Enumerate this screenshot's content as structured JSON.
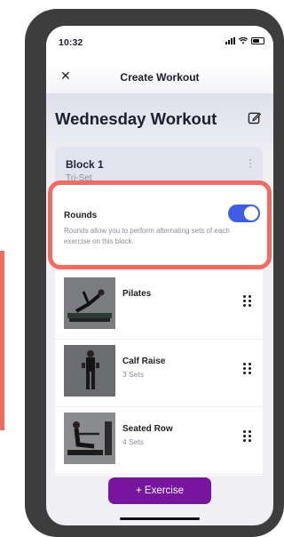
{
  "status": {
    "time": "10:32"
  },
  "nav": {
    "close_icon": "close-icon",
    "title": "Create Workout"
  },
  "workout": {
    "title": "Wednesday Workout",
    "edit_icon": "edit-icon"
  },
  "block": {
    "title": "Block 1",
    "subtitle": "Tri-Set"
  },
  "rounds": {
    "title": "Rounds",
    "description": "Rounds allow you to perform alternating sets of each exercise on this block.",
    "enabled": true
  },
  "exercises": [
    {
      "name": "Pilates",
      "sets": ""
    },
    {
      "name": "Calf Raise",
      "sets": "3 Sets"
    },
    {
      "name": "Seated Row",
      "sets": "4 Sets"
    }
  ],
  "add_button": {
    "label": "+ Exercise"
  },
  "colors": {
    "accent": "#3e5ee6",
    "highlight": "#f36a63",
    "button": "#78159f"
  }
}
